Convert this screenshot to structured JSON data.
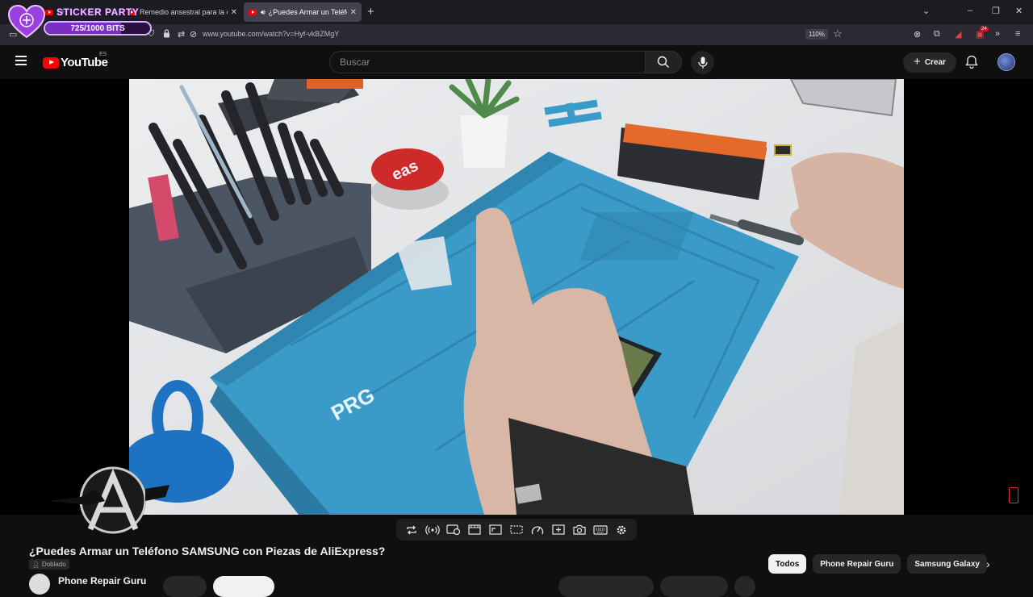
{
  "browser": {
    "tabs": [
      {
        "label": "El",
        "active": false
      },
      {
        "label": "Remedio ansestral para la cruda",
        "active": false
      },
      {
        "label": "¿Puedes Armar un Teléfono",
        "active": true
      }
    ],
    "url": "www.youtube.com/watch?v=Hyf-vkBZMgY",
    "zoom": "110%",
    "extension_badge": "24"
  },
  "sticker_overlay": {
    "title": "STICKER PARTY",
    "count": "725/1000 BITS",
    "progress": 0.725
  },
  "header": {
    "logo_text": "YouTube",
    "country_code": "ES",
    "search_placeholder": "Buscar",
    "create_label": "Crear"
  },
  "video": {
    "title": "¿Puedes Armar un Teléfono SAMSUNG con Piezas de AliExpress?",
    "dub_label": "Doblado",
    "channel_name": "Phone Repair Guru",
    "scene_text": {
      "mat_brand": "PRG",
      "button_text": "eas"
    }
  },
  "chips": [
    {
      "label": "Todos",
      "active": true
    },
    {
      "label": "Phone Repair Guru",
      "active": false
    },
    {
      "label": "Samsung Galaxy",
      "active": false
    }
  ],
  "colors": {
    "yt_red": "#ff0000",
    "background": "#0f0f0f",
    "mat_blue": "#3a9bc8",
    "sticker_purple": "#7a2fc0"
  }
}
